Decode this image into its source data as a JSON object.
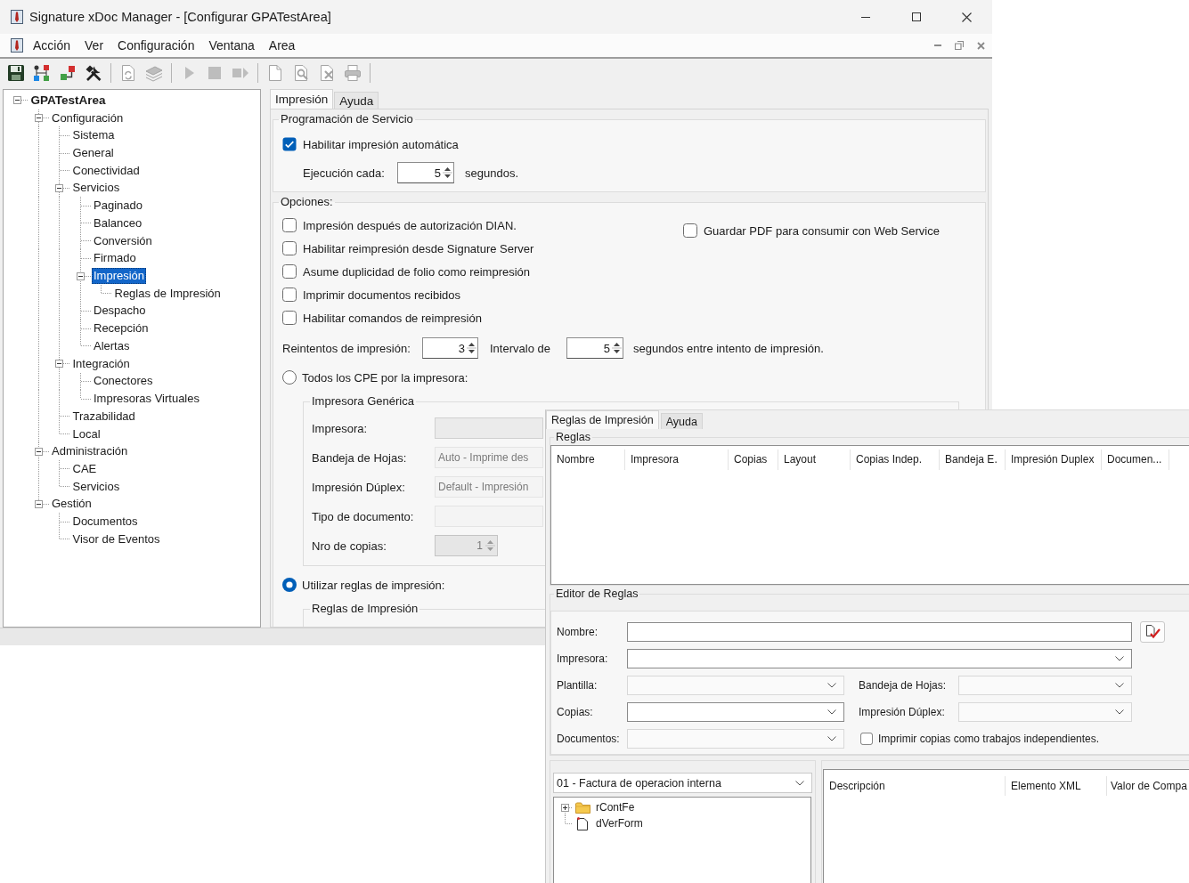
{
  "window": {
    "title": "Signature xDoc Manager - [Configurar GPATestArea]"
  },
  "menu": {
    "items": [
      "Acción",
      "Ver",
      "Configuración",
      "Ventana",
      "Area"
    ]
  },
  "toolbar": {
    "groups": [
      [
        {
          "disabled": false
        },
        {
          "disabled": false
        },
        {
          "disabled": false
        },
        {
          "disabled": false
        }
      ],
      [
        {
          "disabled": true
        },
        {
          "disabled": true
        }
      ],
      [
        {
          "disabled": true
        },
        {
          "disabled": true
        },
        {
          "disabled": true
        }
      ],
      [
        {
          "disabled": true
        },
        {
          "disabled": true
        },
        {
          "disabled": true
        },
        {
          "disabled": true
        }
      ]
    ]
  },
  "tree": [
    {
      "label": "GPATestArea",
      "expanded": true,
      "selected": false,
      "children": [
        {
          "label": "Configuración",
          "expanded": true,
          "selected": false,
          "children": [
            {
              "label": "Sistema",
              "selected": false
            },
            {
              "label": "General",
              "selected": false
            },
            {
              "label": "Conectividad",
              "selected": false
            },
            {
              "label": "Servicios",
              "expanded": true,
              "selected": false,
              "children": [
                {
                  "label": "Paginado",
                  "selected": false
                },
                {
                  "label": "Balanceo",
                  "selected": false
                },
                {
                  "label": "Conversión",
                  "selected": false
                },
                {
                  "label": "Firmado",
                  "selected": false
                },
                {
                  "label": "Impresión",
                  "expanded": true,
                  "selected": true,
                  "children": [
                    {
                      "label": "Reglas de Impresión",
                      "selected": false
                    }
                  ]
                },
                {
                  "label": "Despacho",
                  "selected": false
                },
                {
                  "label": "Recepción",
                  "selected": false
                },
                {
                  "label": "Alertas",
                  "selected": false
                }
              ]
            },
            {
              "label": "Integración",
              "expanded": true,
              "selected": false,
              "children": [
                {
                  "label": "Conectores",
                  "selected": false
                },
                {
                  "label": "Impresoras Virtuales",
                  "selected": false
                }
              ]
            },
            {
              "label": "Trazabilidad",
              "selected": false
            },
            {
              "label": "Local",
              "selected": false
            }
          ]
        },
        {
          "label": "Administración",
          "expanded": true,
          "selected": false,
          "children": [
            {
              "label": "CAE",
              "selected": false
            },
            {
              "label": "Servicios",
              "selected": false
            }
          ]
        },
        {
          "label": "Gestión",
          "expanded": true,
          "selected": false,
          "children": [
            {
              "label": "Documentos",
              "selected": false
            },
            {
              "label": "Visor de Eventos",
              "selected": false
            }
          ]
        }
      ]
    }
  ],
  "config_panel": {
    "tabs": [
      {
        "label": "Impresión",
        "selected": true
      },
      {
        "label": "Ayuda",
        "selected": false
      }
    ],
    "service": {
      "title": "Programación de Servicio",
      "auto_print": {
        "label": "Habilitar impresión automática",
        "checked": true
      },
      "run_every": {
        "label": "Ejecución cada:",
        "value": "5",
        "unit": "segundos."
      }
    },
    "options": {
      "title": "Opciones:",
      "checkboxes": [
        {
          "label": "Impresión después de autorización DIAN.",
          "checked": false
        },
        {
          "label": "Habilitar reimpresión desde Signature Server",
          "checked": false
        },
        {
          "label": "Asume duplicidad de folio como reimpresión",
          "checked": false
        },
        {
          "label": "Imprimir documentos recibidos",
          "checked": false
        },
        {
          "label": "Habilitar comandos de reimpresión",
          "checked": false
        }
      ],
      "side_checkboxes": [
        {
          "label": "Guardar PDF para consumir con Web Service",
          "checked": false
        }
      ],
      "retries": {
        "label": "Reintentos de impresión:",
        "value": "3"
      },
      "interval": {
        "label": "Intervalo de",
        "value": "5",
        "unit": "segundos entre intento de impresión."
      },
      "print_modes": [
        {
          "label": "Todos los CPE por la impresora:",
          "selected": false,
          "group": {
            "title": "Impresora Genérica",
            "fields": [
              {
                "label": "Impresora:",
                "kind": "combo",
                "disabled": true
              },
              {
                "label": "Bandeja de Hojas:",
                "kind": "field",
                "value": "Auto - Imprime des",
                "disabled": true
              },
              {
                "label": "Impresión Dúplex:",
                "kind": "field",
                "value": "Default - Impresión",
                "disabled": true
              },
              {
                "label": "Tipo de documento:",
                "kind": "field",
                "disabled": true
              },
              {
                "label": "Nro de copias:",
                "kind": "spinner",
                "value": "1",
                "disabled": true
              }
            ]
          }
        },
        {
          "label": "Utilizar reglas de impresión:",
          "selected": true,
          "group": {
            "title": "Reglas de Impresión"
          }
        }
      ]
    }
  },
  "rules_window": {
    "tabs": [
      {
        "label": "Reglas de Impresión",
        "selected": true
      },
      {
        "label": "Ayuda",
        "selected": false
      }
    ],
    "rules": {
      "title": "Reglas",
      "columns": [
        "Nombre",
        "Impresora",
        "Copias",
        "Layout",
        "Copias Indep.",
        "Bandeja E.",
        "Impresión Duplex",
        "Documen..."
      ]
    },
    "editor": {
      "title": "Editor de Reglas",
      "name": {
        "label": "Nombre:",
        "disabled": false
      },
      "printer": {
        "label": "Impresora:",
        "disabled": false
      },
      "template": {
        "label": "Plantilla:",
        "disabled": true
      },
      "tray": {
        "label": "Bandeja de Hojas:",
        "disabled": true
      },
      "copies": {
        "label": "Copias:",
        "disabled": false
      },
      "duplex": {
        "label": "Impresión Dúplex:",
        "disabled": true
      },
      "documents": {
        "label": "Documentos:",
        "disabled": true
      },
      "independent_copies": {
        "label": "Imprimir copias como trabajos independientes.",
        "checked": false
      }
    },
    "document_type": {
      "value": "01 - Factura de operacion interna"
    },
    "xml_tree": [
      {
        "label": "rContFe",
        "kind": "folder",
        "expanded": false,
        "selected": false
      },
      {
        "label": "dVerForm",
        "kind": "element",
        "selected": false
      }
    ],
    "conditions": {
      "columns": [
        "Descripción",
        "Elemento XML",
        "Valor de Compa"
      ]
    }
  }
}
